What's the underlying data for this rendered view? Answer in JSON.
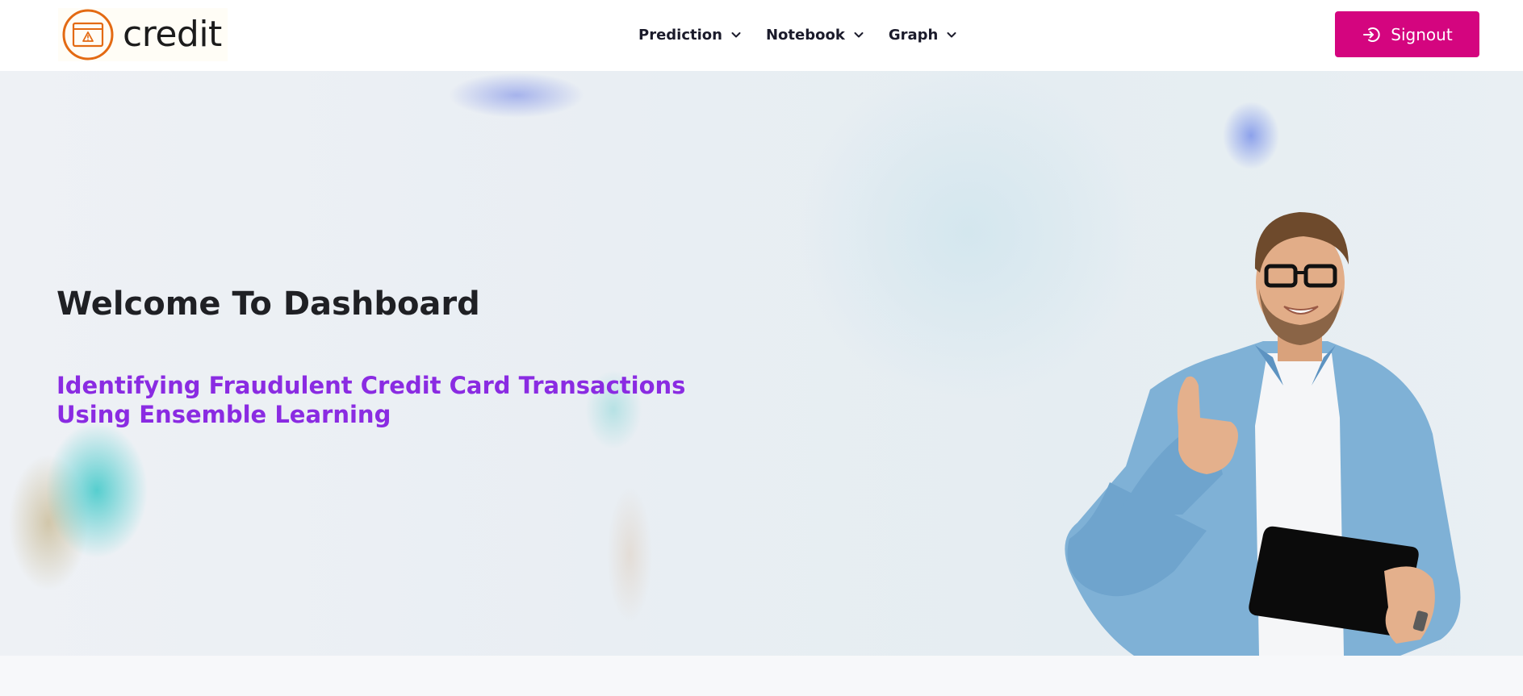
{
  "brand": {
    "name": "credit",
    "accent": "#e36a13"
  },
  "nav": {
    "items": [
      {
        "label": "Prediction"
      },
      {
        "label": "Notebook"
      },
      {
        "label": "Graph"
      }
    ],
    "signout_label": "Signout",
    "signout_color": "#d4057f"
  },
  "hero": {
    "title": "Welcome To Dashboard",
    "subtitle": "Identifying Fraudulent Credit Card Transactions Using Ensemble Learning",
    "subtitle_color": "#8a2be2"
  }
}
